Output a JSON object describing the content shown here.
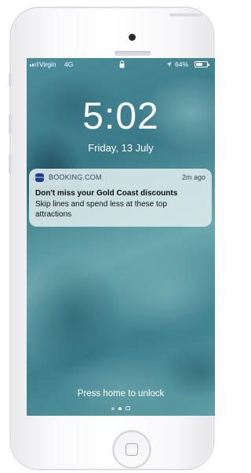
{
  "status_bar": {
    "carrier": "Virgin",
    "network": "4G",
    "battery_percent": "64%",
    "battery_level": 0.64
  },
  "lock_screen": {
    "time": "5:02",
    "date": "Friday, 13 July"
  },
  "notification": {
    "app_name": "BOOKING.COM",
    "app_icon": "booking-app-icon",
    "app_icon_text": "Booking",
    "age": "2m ago",
    "title": "Don't miss your Gold Coast discounts",
    "body": "Skip lines and spend less at these top attractions"
  },
  "unlock_hint": "Press home to unlock",
  "page_indicator": {
    "count": 2,
    "active_index": 1
  },
  "colors": {
    "brand_booking": "#1f3f8e",
    "phone_body": "#ffffff",
    "wallpaper": "#4d8e9c"
  }
}
